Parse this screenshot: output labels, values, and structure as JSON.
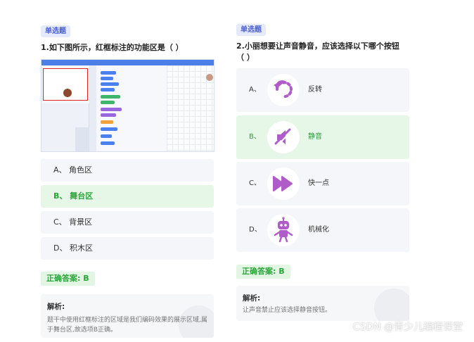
{
  "q1": {
    "tag": "单选题",
    "title": "1.如下图所示，红框标注的功能区是（    ）",
    "options": [
      {
        "label": "A、 角色区",
        "selected": false
      },
      {
        "label": "B、 舞台区",
        "selected": true
      },
      {
        "label": "C、 背景区",
        "selected": false
      },
      {
        "label": "D、 积木区",
        "selected": false
      }
    ],
    "answer": "正确答案: B",
    "explain_title": "解析:",
    "explain_body": "题干中使用红框标注的区域是我们编码效果的展示区域,属于舞台区,故选项B正确。"
  },
  "q2": {
    "tag": "单选题",
    "title_line1": "2.小丽想要让声音静音，应该选择以下哪个按钮",
    "title_line2": "（    ）",
    "options": [
      {
        "letter": "A、",
        "label": "反转",
        "icon": "undo-arrow-icon",
        "selected": false
      },
      {
        "letter": "B、",
        "label": "静音",
        "icon": "mute-icon",
        "selected": true
      },
      {
        "letter": "C、",
        "label": "快一点",
        "icon": "fast-forward-icon",
        "selected": false
      },
      {
        "letter": "D、",
        "label": "机械化",
        "icon": "robot-icon",
        "selected": false
      }
    ],
    "answer": "正确答案: B",
    "explain_title": "解析:",
    "explain_body": "让声音禁止应该选择静音按钮。"
  },
  "colors": {
    "accent_blue": "#4a5fd4",
    "correct_green": "#2aa33a",
    "icon_purple": "#b05cc8",
    "stage_red": "#e12424"
  },
  "watermark": "CSDN @青少儿编程课堂"
}
